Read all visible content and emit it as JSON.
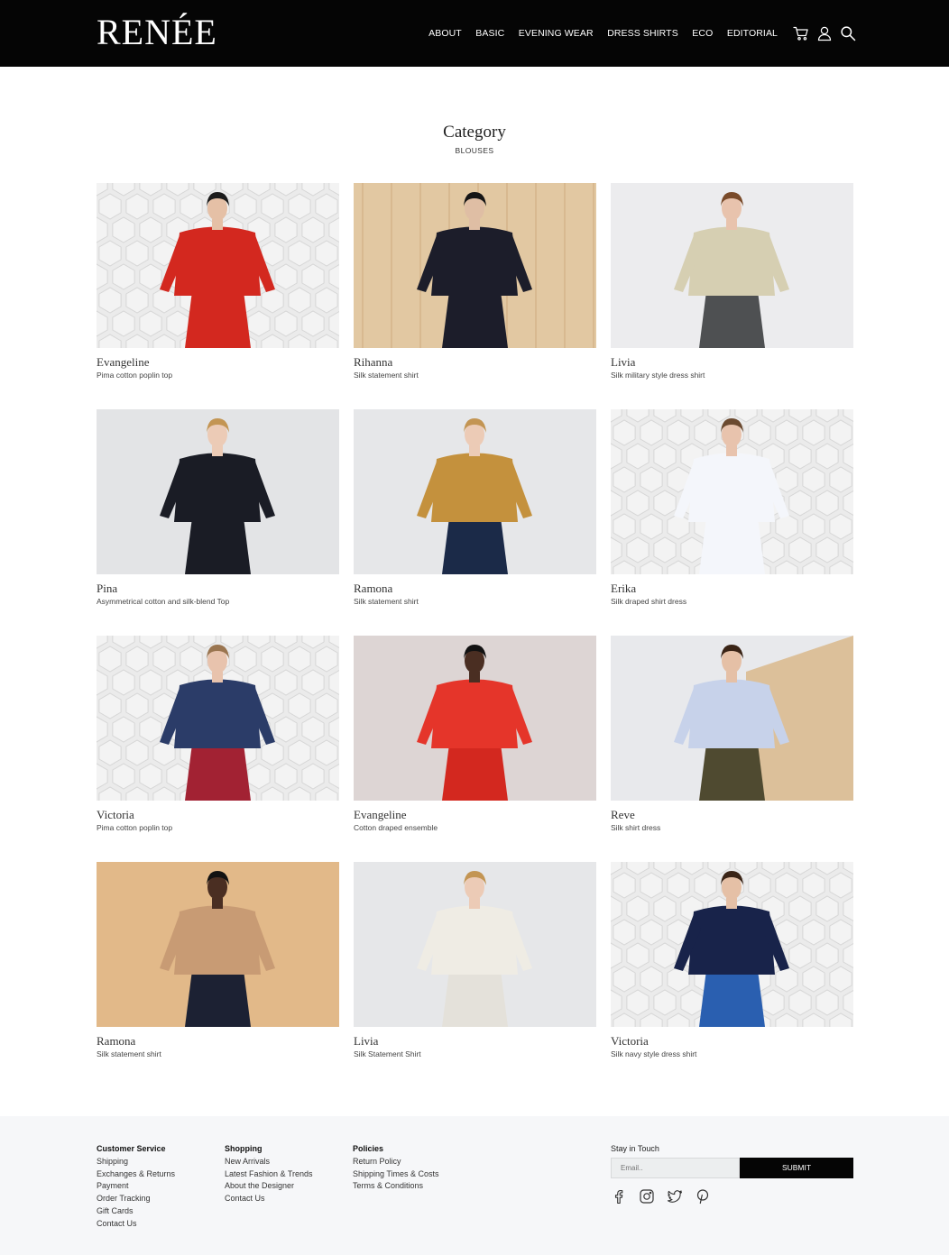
{
  "brand": {
    "logo": "RENÉE"
  },
  "nav": {
    "items": [
      "ABOUT",
      "BASIC",
      "EVENING WEAR",
      "DRESS SHIRTS",
      "ECO",
      "EDITORIAL"
    ],
    "icons": [
      "cart-icon",
      "user-icon",
      "search-icon"
    ]
  },
  "category": {
    "title": "Category",
    "subtitle": "BLOUSES"
  },
  "products": [
    {
      "name": "Evangeline",
      "desc": "Pima cotton poplin top",
      "bg": "#ebebeb",
      "pattern": "hex",
      "top": "#d3281f",
      "bottom": "#d3281f",
      "skin": "#e5c0a6",
      "hair": "#1b1b1b"
    },
    {
      "name": "Rihanna",
      "desc": "Silk statement shirt",
      "bg": "#e2c8a2",
      "pattern": "wood",
      "top": "#1c1d2a",
      "bottom": "#1c1d2a",
      "skin": "#dfbea4",
      "hair": "#151515"
    },
    {
      "name": "Livia",
      "desc": "Silk military style dress shirt",
      "bg": "#ececee",
      "pattern": "none",
      "top": "#d6cfb2",
      "bottom": "#4e5052",
      "skin": "#e8c3ad",
      "hair": "#7a4b2a"
    },
    {
      "name": "Pina",
      "desc": "Asymmetrical cotton and silk-blend Top",
      "bg": "#e3e4e6",
      "pattern": "none",
      "top": "#1a1c25",
      "bottom": "#1a1c25",
      "skin": "#eccbb6",
      "hair": "#c39553"
    },
    {
      "name": "Ramona",
      "desc": "Silk statement shirt",
      "bg": "#e6e7e9",
      "pattern": "none",
      "top": "#c4913d",
      "bottom": "#1b2a48",
      "skin": "#eccbb6",
      "hair": "#c39553"
    },
    {
      "name": "Erika",
      "desc": "Silk draped shirt dress",
      "bg": "#ebebeb",
      "pattern": "hex",
      "top": "#f4f6fb",
      "bottom": "#f4f6fb",
      "skin": "#e8c3ad",
      "hair": "#6b4a30"
    },
    {
      "name": "Victoria",
      "desc": "Pima cotton poplin top",
      "bg": "#ebebeb",
      "pattern": "hex",
      "top": "#2b3c68",
      "bottom": "#a22233",
      "skin": "#e8c3ad",
      "hair": "#9a7550"
    },
    {
      "name": "Evangeline",
      "desc": "Cotton draped ensemble",
      "bg": "#ddd5d4",
      "pattern": "none",
      "top": "#e5352a",
      "bottom": "#d3281f",
      "skin": "#4a2e22",
      "hair": "#121212"
    },
    {
      "name": "Reve",
      "desc": "Silk shirt dress",
      "bg": "#e8e9ec",
      "pattern": "woodright",
      "top": "#c7d2ea",
      "bottom": "#4f4a30",
      "skin": "#e5c0a6",
      "hair": "#3a2416"
    },
    {
      "name": "Ramona",
      "desc": "Silk statement shirt",
      "bg": "#e2b989",
      "pattern": "none",
      "top": "#c89b74",
      "bottom": "#1c2133",
      "skin": "#4a2e22",
      "hair": "#121212"
    },
    {
      "name": "Livia",
      "desc": "Silk Statement Shirt",
      "bg": "#e6e7e9",
      "pattern": "none",
      "top": "#efece4",
      "bottom": "#e4e1da",
      "skin": "#eccbb6",
      "hair": "#c39553"
    },
    {
      "name": "Victoria",
      "desc": "Silk navy style dress shirt",
      "bg": "#ebebeb",
      "pattern": "hex",
      "top": "#18234a",
      "bottom": "#2a5fb0",
      "skin": "#e5c0a6",
      "hair": "#3a2416"
    }
  ],
  "footer": {
    "customer_service": {
      "title": "Customer Service",
      "links": [
        "Shipping",
        "Exchanges & Returns",
        "Payment",
        "Order Tracking",
        "Gift Cards",
        "Contact Us"
      ]
    },
    "shopping": {
      "title": "Shopping",
      "links": [
        "New Arrivals",
        "Latest Fashion & Trends",
        "About the Designer",
        "Contact Us"
      ]
    },
    "policies": {
      "title": "Policies",
      "links": [
        "Return Policy",
        "Shipping Times & Costs",
        "Terms & Conditions"
      ]
    },
    "newsletter": {
      "title": "Stay in Touch",
      "placeholder": "Email..",
      "submit": "SUBMIT"
    },
    "social": [
      "facebook-icon",
      "instagram-icon",
      "twitter-icon",
      "pinterest-icon"
    ]
  }
}
